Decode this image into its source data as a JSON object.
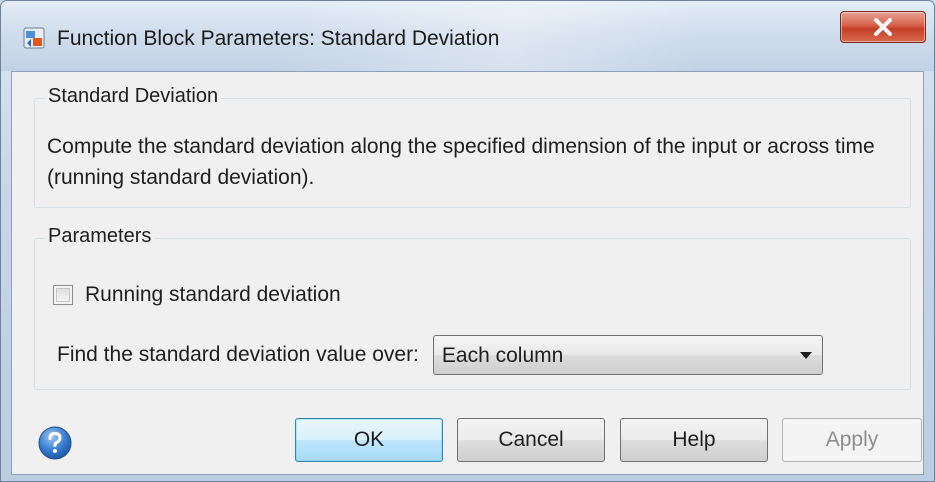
{
  "window": {
    "title": "Function Block Parameters: Standard Deviation"
  },
  "description_group": {
    "legend": "Standard Deviation",
    "text": "Compute the standard deviation along the specified dimension of the input or across time (running standard deviation)."
  },
  "parameters_group": {
    "legend": "Parameters",
    "running_checkbox": {
      "label": "Running standard deviation",
      "checked": false
    },
    "find_over": {
      "label": "Find the standard deviation value over:",
      "value": "Each column"
    }
  },
  "buttons": {
    "ok": "OK",
    "cancel": "Cancel",
    "help": "Help",
    "apply": "Apply"
  },
  "colors": {
    "ok_border": "#3c7fb1",
    "close_red": "#c33f27",
    "dialog_bg": "#f0f0f0"
  }
}
